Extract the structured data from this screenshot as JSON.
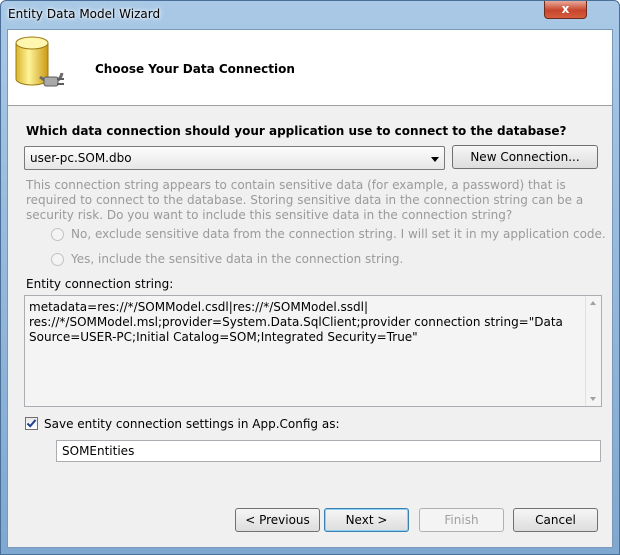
{
  "window": {
    "title": "Entity Data Model Wizard",
    "close_label": "x"
  },
  "header": {
    "title": "Choose Your Data Connection"
  },
  "connection": {
    "question": "Which data connection should your application use to connect to the database?",
    "selected": "user-pc.SOM.dbo",
    "new_connection_label": "New Connection..."
  },
  "sensitive": {
    "message": "This connection string appears to contain sensitive data (for example, a password) that is required to connect to the database. Storing sensitive data in the connection string can be a security risk. Do you want to include this sensitive data in the connection string?",
    "option_no": "No, exclude sensitive data from the connection string. I will set it in my application code.",
    "option_yes": "Yes, include the sensitive data in the connection string."
  },
  "entity_connection": {
    "label": "Entity connection string:",
    "line1": "metadata=res://*/SOMModel.csdl|res://*/SOMModel.ssdl|",
    "line2": "res://*/SOMModel.msl;provider=System.Data.SqlClient;provider connection string=\"Data",
    "line3": "Source=USER-PC;Initial Catalog=SOM;Integrated Security=True\""
  },
  "save_settings": {
    "checked": true,
    "label": "Save entity connection settings in App.Config as:",
    "value": "SOMEntities"
  },
  "buttons": {
    "previous": "< Previous",
    "next": "Next >",
    "finish": "Finish",
    "cancel": "Cancel"
  },
  "colors": {
    "title_bar": "#a9c9e6",
    "close_button": "#c7452c",
    "disabled_text": "#9a9a9a",
    "dialog_background": "#f0f0f0"
  }
}
